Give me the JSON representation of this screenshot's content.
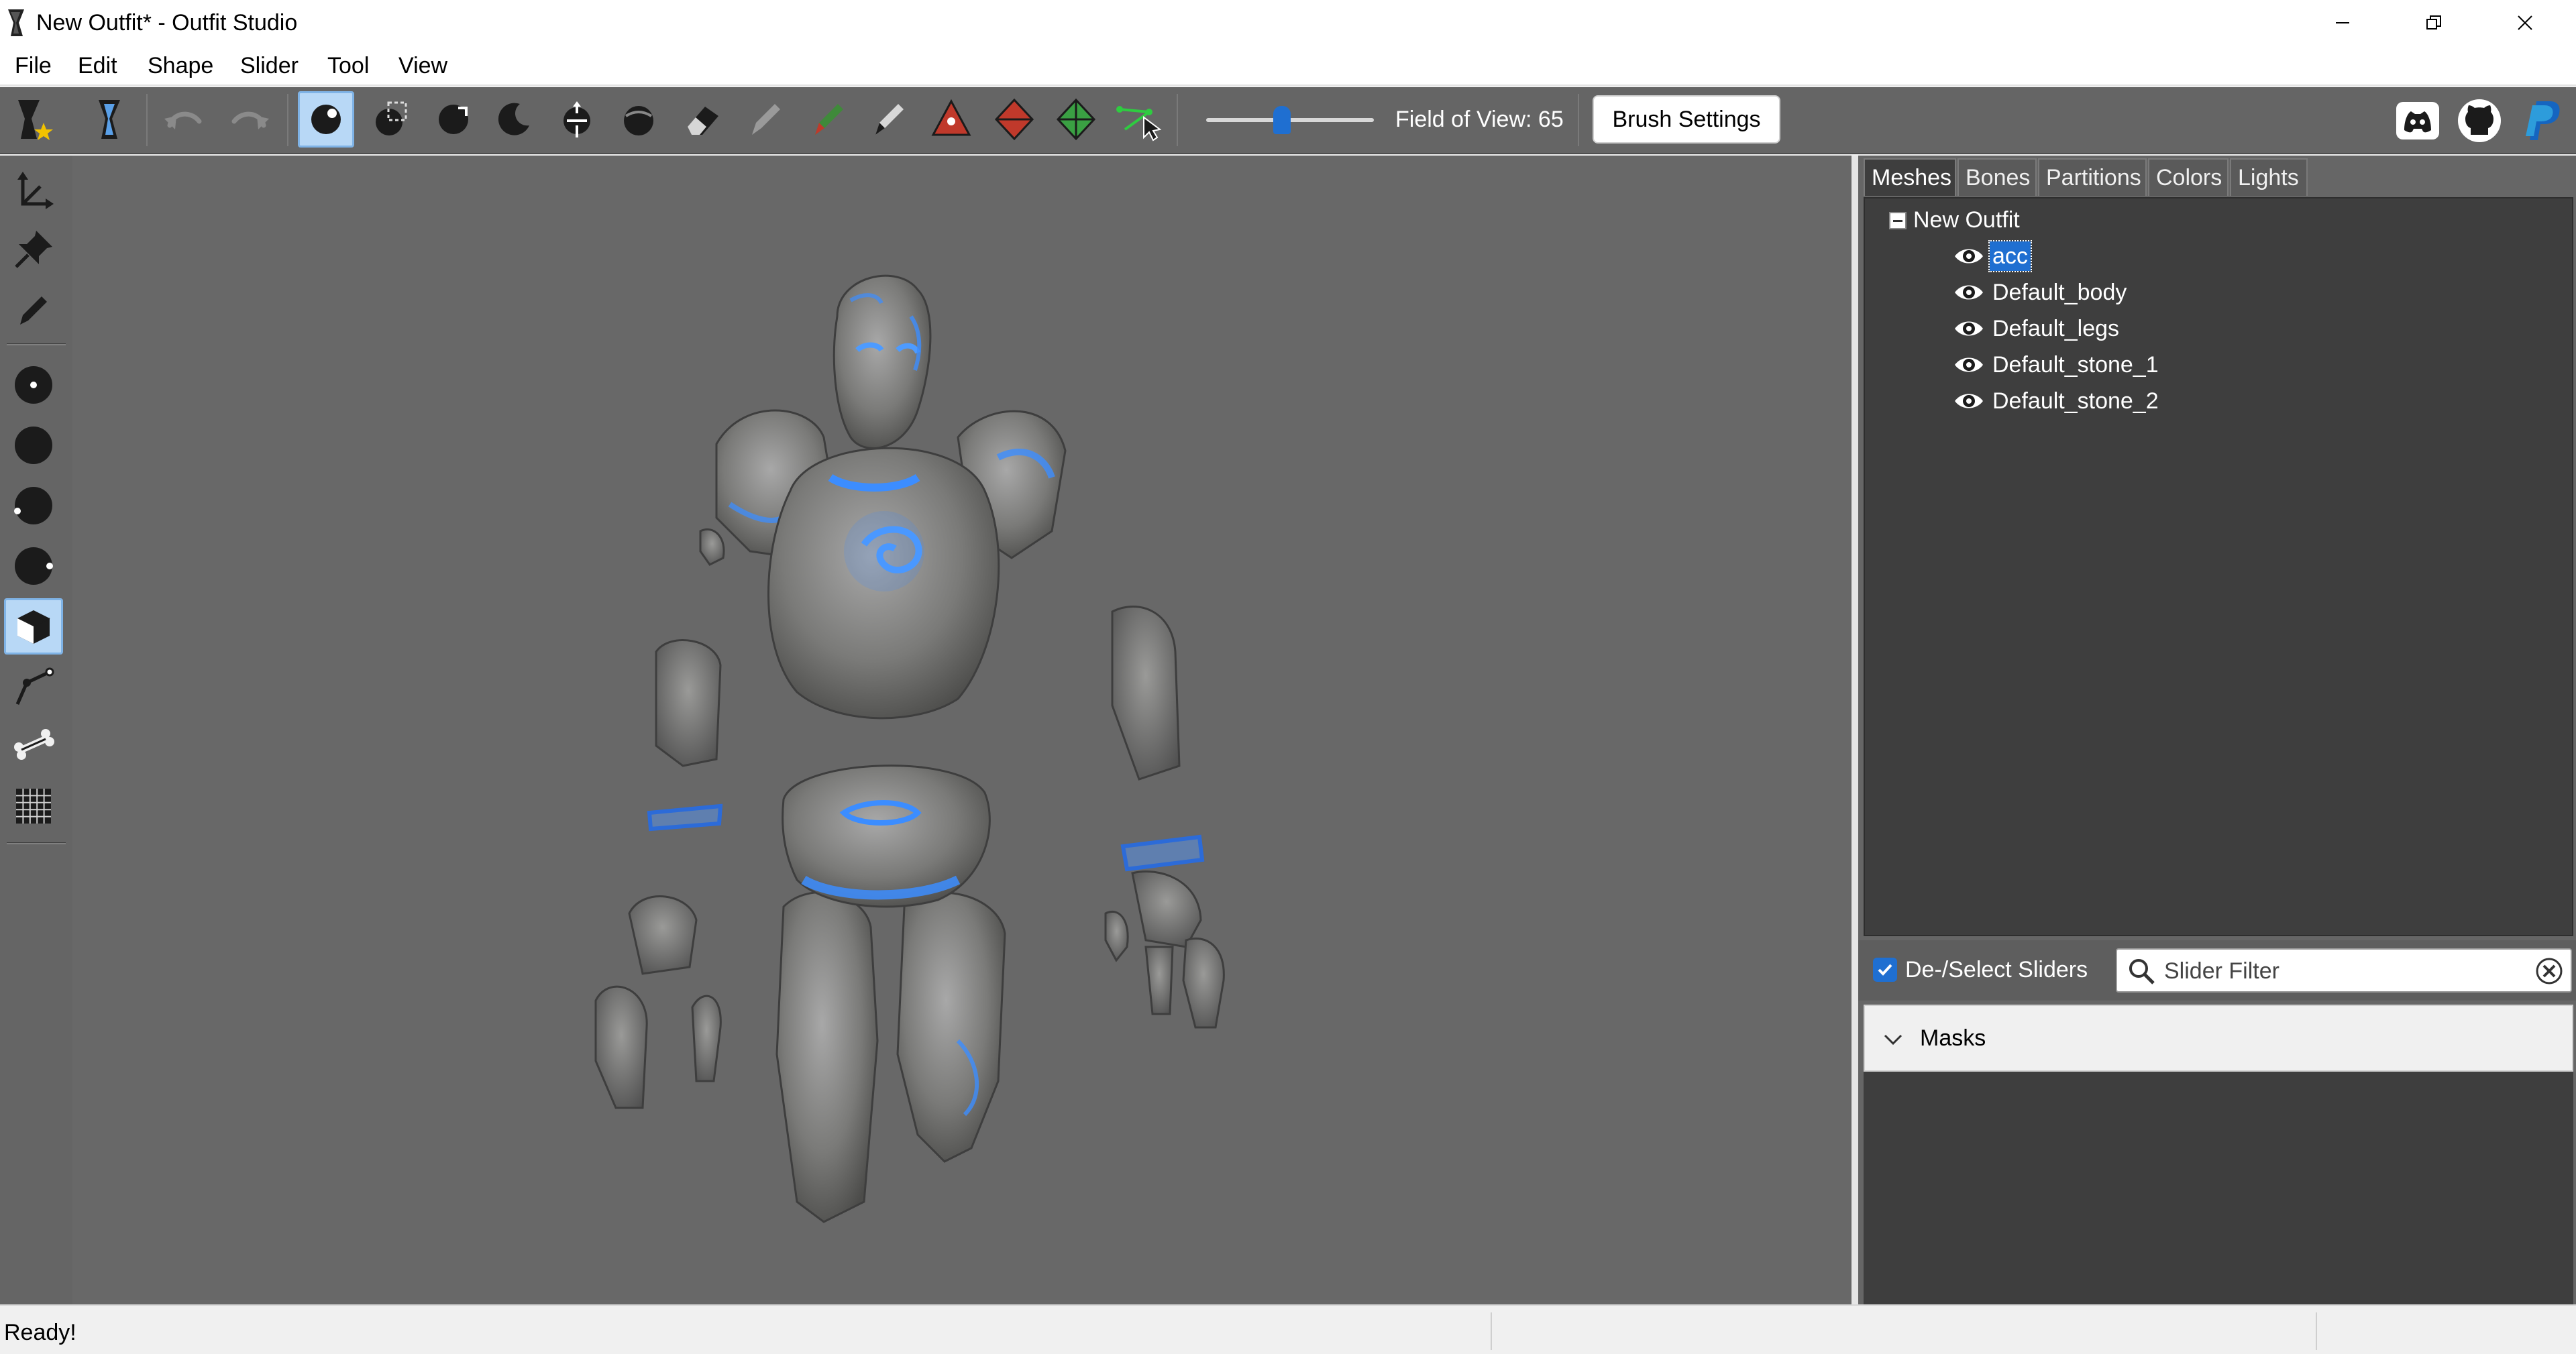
{
  "window": {
    "title": "New Outfit* - Outfit Studio"
  },
  "menu": {
    "items": [
      "File",
      "Edit",
      "Shape",
      "Slider",
      "Tool",
      "View"
    ]
  },
  "toolbar": {
    "fov_label": "Field of View: 65",
    "fov_value": 65,
    "brush_settings_label": "Brush Settings",
    "active_tool": "standard-brush"
  },
  "left_tools": {
    "active_tool": "vertex-select"
  },
  "right_panel": {
    "tabs": [
      {
        "label": "Meshes",
        "active": true
      },
      {
        "label": "Bones",
        "active": false
      },
      {
        "label": "Partitions",
        "active": false
      },
      {
        "label": "Colors",
        "active": false
      },
      {
        "label": "Lights",
        "active": false
      }
    ],
    "tree": {
      "root": "New Outfit",
      "meshes": [
        {
          "label": "acc",
          "selected": true
        },
        {
          "label": "Default_body",
          "selected": false
        },
        {
          "label": "Default_legs",
          "selected": false
        },
        {
          "label": "Default_stone_1",
          "selected": false
        },
        {
          "label": "Default_stone_2",
          "selected": false
        }
      ]
    },
    "sliders": {
      "deselect_label": "De-/Select Sliders",
      "deselect_checked": true,
      "filter_placeholder": "Slider Filter",
      "masks_label": "Masks"
    }
  },
  "status": {
    "text": "Ready!"
  },
  "colors": {
    "accent": "#1f6fd1",
    "panel_dark": "#3e3e3e",
    "toolbar": "#656565",
    "viewport": "#686868",
    "glow": "#3c8dff"
  }
}
